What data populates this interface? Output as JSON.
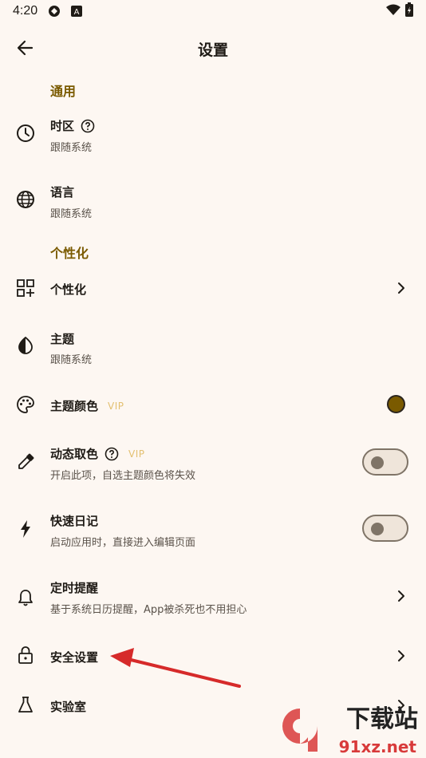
{
  "status_bar": {
    "time": "4:20",
    "icons": [
      "sync-icon",
      "a-badge-icon",
      "wifi-icon",
      "battery-icon"
    ]
  },
  "appbar": {
    "title": "设置",
    "back_icon": "arrow-left-icon"
  },
  "sections": {
    "general": "通用",
    "personalize": "个性化"
  },
  "items": {
    "timezone": {
      "title": "时区",
      "subtitle": "跟随系统",
      "icon": "clock-icon"
    },
    "language": {
      "title": "语言",
      "subtitle": "跟随系统",
      "icon": "globe-icon"
    },
    "personalize": {
      "title": "个性化",
      "icon": "widgets-icon"
    },
    "theme": {
      "title": "主题",
      "subtitle": "跟随系统",
      "icon": "contrast-icon"
    },
    "theme_color": {
      "title": "主题颜色",
      "vip": "VIP",
      "icon": "palette-icon",
      "color": "#7a5a00"
    },
    "dynamic_color": {
      "title": "动态取色",
      "vip": "VIP",
      "subtitle": "开启此项，自选主题颜色将失效",
      "icon": "eyedropper-icon",
      "enabled": false
    },
    "quick_diary": {
      "title": "快速日记",
      "subtitle": "启动应用时，直接进入编辑页面",
      "icon": "bolt-icon",
      "enabled": false
    },
    "reminder": {
      "title": "定时提醒",
      "subtitle": "基于系统日历提醒，App被杀死也不用担心",
      "icon": "bell-icon"
    },
    "security": {
      "title": "安全设置",
      "icon": "lock-icon"
    },
    "lab": {
      "title": "实验室",
      "icon": "flask-icon"
    }
  },
  "watermark": {
    "line1": "下载站",
    "line2": "91xz.net"
  },
  "colors": {
    "accent": "#7a5a00",
    "background": "#fdf7f2",
    "annotation_arrow": "#d62a2a"
  }
}
